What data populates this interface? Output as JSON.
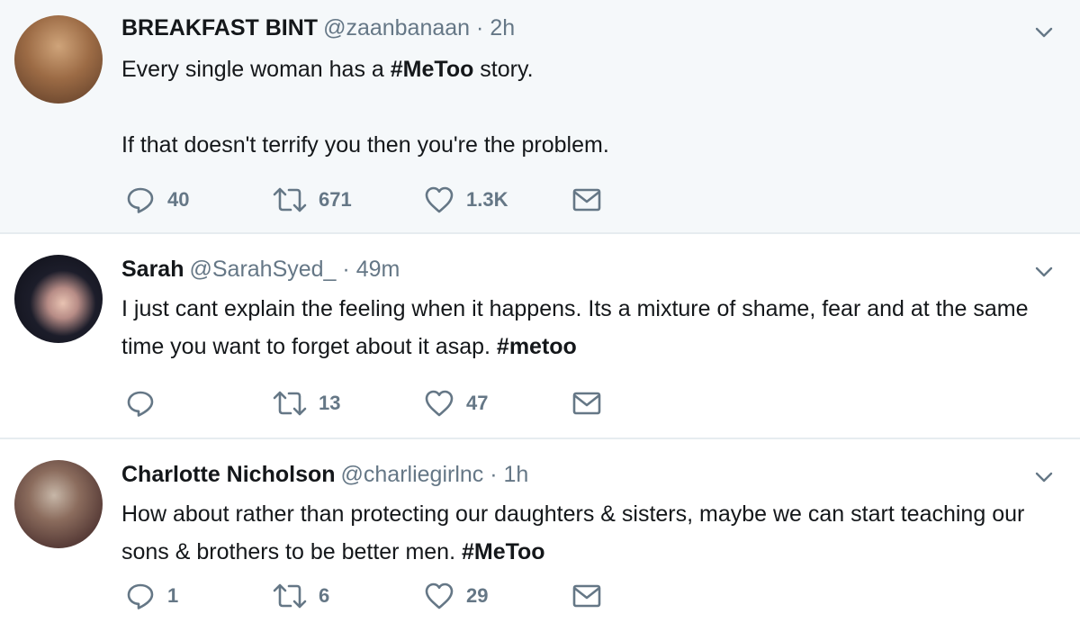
{
  "tweets": [
    {
      "display_name": "BREAKFAST BINT",
      "handle": "@zaanbanaan",
      "separator": "·",
      "time": "2h",
      "text_line1_pre": "Every single woman has a ",
      "text_line1_tag": "#MeToo",
      "text_line1_post": " story.",
      "text_line2": "If that doesn't terrify you then you're the problem.",
      "replies": "40",
      "retweets": "671",
      "likes": "1.3K"
    },
    {
      "display_name": "Sarah",
      "handle": "@SarahSyed_",
      "separator": "·",
      "time": "49m",
      "text_pre": "I just cant explain the feeling when it happens. Its a mixture of shame, fear and at the same time you want to forget about it asap. ",
      "text_tag": "#metoo",
      "replies": "",
      "retweets": "13",
      "likes": "47"
    },
    {
      "display_name": "Charlotte Nicholson",
      "handle": "@charliegirlnc",
      "separator": "·",
      "time": "1h",
      "text_pre": "How about rather than protecting our daughters & sisters, maybe we can start teaching our sons & brothers to be better men. ",
      "text_tag": "#MeToo",
      "replies": "1",
      "retweets": "6",
      "likes": "29"
    }
  ],
  "icons": {
    "reply": "reply-icon",
    "retweet": "retweet-icon",
    "like": "heart-icon",
    "dm": "envelope-icon",
    "caret": "chevron-down-icon"
  },
  "colors": {
    "highlight_bg": "#f5f8fa",
    "muted_text": "#657786",
    "divider": "#e6ecf0"
  }
}
